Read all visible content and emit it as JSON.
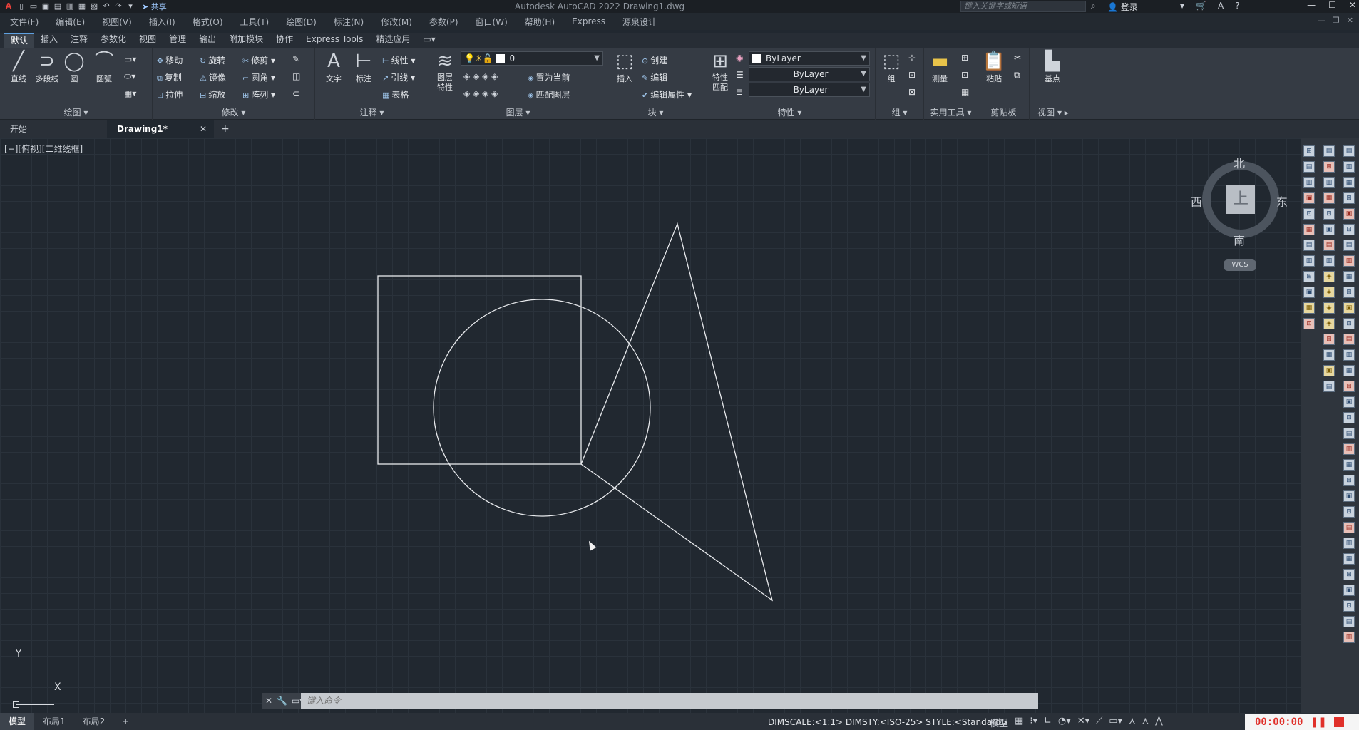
{
  "title_bar": {
    "app_title": "Autodesk AutoCAD 2022    Drawing1.dwg",
    "share_label": "共享",
    "search_placeholder": "键入关键字或短语",
    "login_label": "登录"
  },
  "menu_bar": {
    "items": [
      "文件(F)",
      "编辑(E)",
      "视图(V)",
      "插入(I)",
      "格式(O)",
      "工具(T)",
      "绘图(D)",
      "标注(N)",
      "修改(M)",
      "参数(P)",
      "窗口(W)",
      "帮助(H)",
      "Express",
      "源泉设计"
    ]
  },
  "ribbon_tabs": [
    "默认",
    "插入",
    "注释",
    "参数化",
    "视图",
    "管理",
    "输出",
    "附加模块",
    "协作",
    "Express Tools",
    "精选应用"
  ],
  "ribbon": {
    "draw": {
      "title": "绘图",
      "line": "直线",
      "polyline": "多段线",
      "circle": "圆",
      "arc": "圆弧"
    },
    "modify": {
      "title": "修改",
      "move": "移动",
      "rotate": "旋转",
      "trim": "修剪",
      "copy": "复制",
      "mirror": "镜像",
      "fillet": "圆角",
      "stretch": "拉伸",
      "scale": "缩放",
      "array": "阵列"
    },
    "annotation": {
      "title": "注释",
      "text": "文字",
      "dimension": "标注",
      "linear": "线性",
      "leader": "引线",
      "table": "表格"
    },
    "layers": {
      "title": "图层",
      "properties": "图层\n特性",
      "current_layer": "0",
      "set_current": "置为当前",
      "match_layer": "匹配图层"
    },
    "block": {
      "title": "块",
      "insert": "插入",
      "create": "创建",
      "edit": "编辑",
      "edit_attr": "编辑属性"
    },
    "properties": {
      "title": "特性",
      "match": "特性\n匹配",
      "color": "ByLayer",
      "linetype": "ByLayer",
      "lineweight": "ByLayer"
    },
    "groups": {
      "title": "组",
      "group": "组"
    },
    "utilities": {
      "title": "实用工具",
      "measure": "测量"
    },
    "clipboard": {
      "title": "剪贴板",
      "paste": "粘贴"
    },
    "view": {
      "title": "视图",
      "base": "基点"
    }
  },
  "doc_tabs": {
    "start": "开始",
    "drawing": "Drawing1*"
  },
  "viewport_label": "[−][俯视][二维线框]",
  "viewcube": {
    "north": "北",
    "south": "南",
    "west": "西",
    "east": "东",
    "top": "上",
    "wcs": "WCS"
  },
  "ucs": {
    "x": "X",
    "y": "Y"
  },
  "command_line": {
    "placeholder": "键入命令"
  },
  "status_bar": {
    "tabs": [
      "模型",
      "布局1",
      "布局2"
    ],
    "dim_info": "DIMSCALE:<1:1> DIMSTY:<ISO-25> STYLE:<Standard>",
    "model_label": "模型"
  },
  "recorder": {
    "time": "00:00:00"
  },
  "colors": {
    "background": "#212830",
    "ribbon": "#353b44",
    "accent": "#5ea0e0",
    "recorder_red": "#e0302a"
  }
}
